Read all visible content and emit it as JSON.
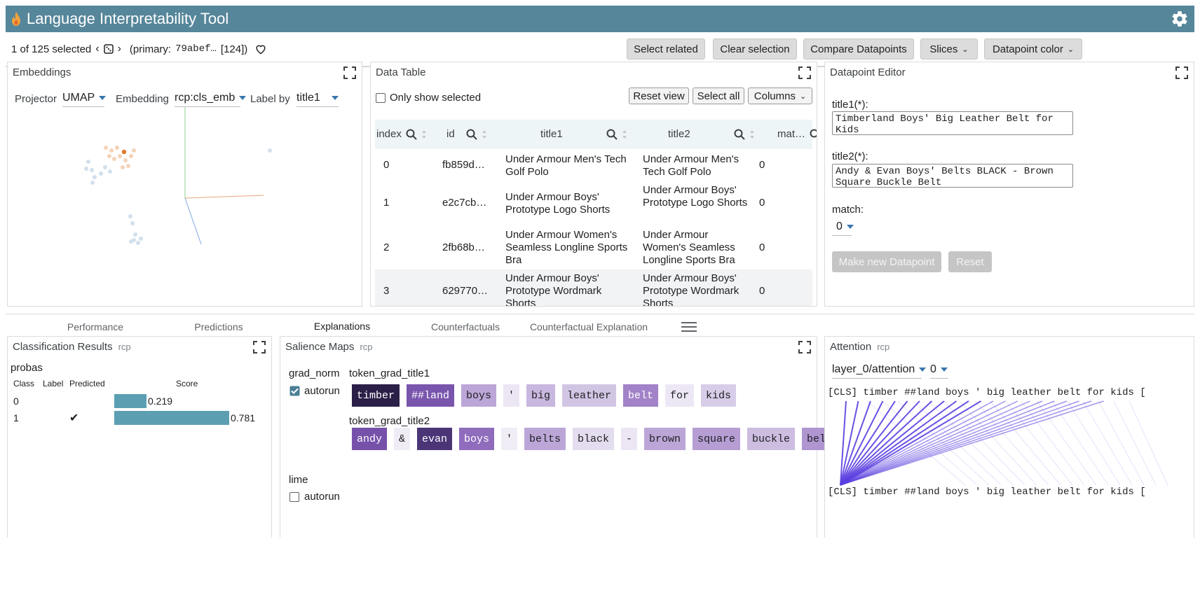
{
  "app": {
    "title": "Language Interpretability Tool"
  },
  "selection": {
    "summary": "1 of 125 selected",
    "primary_label": "(primary:",
    "primary_id": "79abef…",
    "primary_index": "[124])"
  },
  "toolbar": {
    "select_related": "Select related",
    "clear_selection": "Clear selection",
    "compare": "Compare Datapoints",
    "slices": "Slices",
    "datapoint_color": "Datapoint color"
  },
  "embeddings": {
    "title": "Embeddings",
    "projector_label": "Projector",
    "projector_value": "UMAP",
    "embedding_label": "Embedding",
    "embedding_value": "rcp:cls_emb",
    "labelby_label": "Label by",
    "labelby_value": "title1"
  },
  "data_table": {
    "title": "Data Table",
    "only_selected": "Only show selected",
    "reset_view": "Reset view",
    "select_all": "Select all",
    "columns": "Columns",
    "headers": [
      "index",
      "id",
      "title1",
      "title2",
      "mat…"
    ],
    "rows": [
      {
        "index": "0",
        "id": "fb859d…",
        "title1": "Under Armour Men's Tech Golf Polo",
        "title2": "Under Armour Men's Tech Golf Polo",
        "match": "0"
      },
      {
        "index": "1",
        "id": "e2c7cb…",
        "title1": "Under Armour Boys' Prototype Logo Shorts",
        "title2": "Under Armour Boys' Prototype Logo Shorts",
        "match": "0"
      },
      {
        "index": "2",
        "id": "2fb68b…",
        "title1": "Under Armour Women's Seamless Longline Sports Bra",
        "title2": "Under Armour Women's Seamless Longline Sports Bra",
        "match": "0"
      },
      {
        "index": "3",
        "id": "629770…",
        "title1": "Under Armour Boys' Prototype Wordmark Shorts",
        "title2": "Under Armour Boys' Prototype Wordmark Shorts",
        "match": "0"
      }
    ]
  },
  "editor": {
    "title": "Datapoint Editor",
    "title1_label": "title1(*):",
    "title1_value": "Timberland Boys' Big Leather Belt for Kids",
    "title2_label": "title2(*):",
    "title2_value": "Andy & Evan Boys' Belts BLACK - Brown Square Buckle Belt",
    "match_label": "match:",
    "match_value": "0",
    "make_new": "Make new Datapoint",
    "reset": "Reset"
  },
  "tabs": [
    "Performance",
    "Predictions",
    "Explanations",
    "Counterfactuals",
    "Counterfactual Explanation"
  ],
  "active_tab": "Explanations",
  "classification": {
    "title": "Classification Results",
    "model": "rcp",
    "field": "probas",
    "headers": [
      "Class",
      "Label",
      "Predicted",
      "Score"
    ],
    "rows": [
      {
        "class": "0",
        "label": "",
        "predicted": "",
        "score": 0.219,
        "score_text": "0.219"
      },
      {
        "class": "1",
        "label": "",
        "predicted": "✔",
        "score": 0.781,
        "score_text": "0.781"
      }
    ]
  },
  "salience": {
    "title": "Salience Maps",
    "model": "rcp",
    "method1": "grad_norm",
    "autorun": "autorun",
    "field1": "token_grad_title1",
    "tokens1": [
      {
        "t": "timber",
        "bg": "#2b1f48",
        "fg": "#ffffff"
      },
      {
        "t": "##land",
        "bg": "#7a55ad",
        "fg": "#ffffff"
      },
      {
        "t": "boys",
        "bg": "#bca6d8",
        "fg": "#202124"
      },
      {
        "t": "'",
        "bg": "#ece6f4",
        "fg": "#202124"
      },
      {
        "t": "big",
        "bg": "#c8b7de",
        "fg": "#202124"
      },
      {
        "t": "leather",
        "bg": "#d2c5e4",
        "fg": "#202124"
      },
      {
        "t": "belt",
        "bg": "#a282c8",
        "fg": "#ffffff"
      },
      {
        "t": "for",
        "bg": "#ede7f5",
        "fg": "#202124"
      },
      {
        "t": "kids",
        "bg": "#d8cde8",
        "fg": "#202124"
      }
    ],
    "field2": "token_grad_title2",
    "tokens2": [
      {
        "t": "andy",
        "bg": "#7651aa",
        "fg": "#ffffff"
      },
      {
        "t": "&",
        "bg": "#f0ecf6",
        "fg": "#202124"
      },
      {
        "t": "evan",
        "bg": "#4b3577",
        "fg": "#ffffff"
      },
      {
        "t": "boys",
        "bg": "#8f6cbc",
        "fg": "#ffffff"
      },
      {
        "t": "'",
        "bg": "#f1edf7",
        "fg": "#202124"
      },
      {
        "t": "belts",
        "bg": "#bca6d8",
        "fg": "#202124"
      },
      {
        "t": "black",
        "bg": "#e4dcef",
        "fg": "#202124"
      },
      {
        "t": "-",
        "bg": "#ece6f4",
        "fg": "#202124"
      },
      {
        "t": "brown",
        "bg": "#bca6d8",
        "fg": "#202124"
      },
      {
        "t": "square",
        "bg": "#b69ed4",
        "fg": "#202124"
      },
      {
        "t": "buckle",
        "bg": "#cdbde0",
        "fg": "#202124"
      },
      {
        "t": "belt",
        "bg": "#b096d0",
        "fg": "#202124"
      }
    ],
    "method2": "lime",
    "autorun2": "autorun"
  },
  "attention": {
    "title": "Attention",
    "model": "rcp",
    "layer": "layer_0/attention",
    "head": "0",
    "tokens_line": "[CLS] timber ##land boys ' big leather belt for kids ["
  },
  "colors": {
    "header": "#56869a",
    "bar": "#5c9fb3",
    "attention": "#5b3fe0"
  }
}
